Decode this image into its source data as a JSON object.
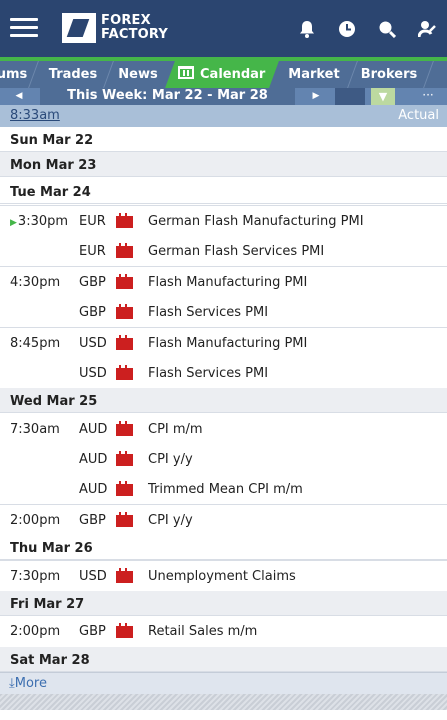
{
  "header": {
    "logo_line1": "FOREX",
    "logo_line2": "FACTORY",
    "icons": [
      "menu-icon",
      "bell-icon",
      "clock-icon",
      "search-icon",
      "user-icon"
    ]
  },
  "tabs": [
    {
      "label": "ums"
    },
    {
      "label": "Trades"
    },
    {
      "label": "News"
    },
    {
      "label": "Calendar",
      "active": true
    },
    {
      "label": "Market"
    },
    {
      "label": "Brokers"
    }
  ],
  "week": {
    "label": "This Week: Mar 22 - Mar 28"
  },
  "status": {
    "time": "8:33am",
    "actual_header": "Actual"
  },
  "days": [
    {
      "label": "Sun Mar 22"
    },
    {
      "label": "Mon Mar 23"
    },
    {
      "label": "Tue Mar 24"
    },
    {
      "label": "Wed Mar 25"
    },
    {
      "label": "Thu Mar 26"
    },
    {
      "label": "Fri Mar 27"
    },
    {
      "label": "Sat Mar 28"
    }
  ],
  "events": [
    {
      "time": "3:30pm",
      "currency": "EUR",
      "title": "German Flash Manufacturing PMI",
      "next": true
    },
    {
      "time": "",
      "currency": "EUR",
      "title": "German Flash Services PMI"
    },
    {
      "time": "4:30pm",
      "currency": "GBP",
      "title": "Flash Manufacturing PMI"
    },
    {
      "time": "",
      "currency": "GBP",
      "title": "Flash Services PMI"
    },
    {
      "time": "8:45pm",
      "currency": "USD",
      "title": "Flash Manufacturing PMI"
    },
    {
      "time": "",
      "currency": "USD",
      "title": "Flash Services PMI"
    },
    {
      "time": "7:30am",
      "currency": "AUD",
      "title": "CPI m/m"
    },
    {
      "time": "",
      "currency": "AUD",
      "title": "CPI y/y"
    },
    {
      "time": "",
      "currency": "AUD",
      "title": "Trimmed Mean CPI m/m"
    },
    {
      "time": "2:00pm",
      "currency": "GBP",
      "title": "CPI y/y"
    },
    {
      "time": "7:30pm",
      "currency": "USD",
      "title": "Unemployment Claims"
    },
    {
      "time": "2:00pm",
      "currency": "GBP",
      "title": "Retail Sales m/m"
    }
  ],
  "more": {
    "label": "More"
  },
  "colors": {
    "header_bg": "#2b4570",
    "accent_green": "#45b649",
    "high_impact": "#cc1f1f"
  }
}
